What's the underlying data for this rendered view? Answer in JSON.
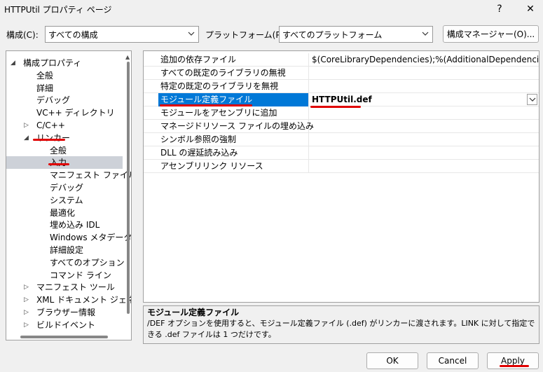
{
  "window": {
    "title": "HTTPUtil プロパティ ページ",
    "help_label": "?",
    "close_label": "✕"
  },
  "toolbar": {
    "config_label": "構成(C):",
    "config_value": "すべての構成",
    "platform_label": "プラットフォーム(P):",
    "platform_value": "すべてのプラットフォーム",
    "manager_button": "構成マネージャー(O)...",
    "dropdown_icon": "chevron-down-icon"
  },
  "tree": {
    "items": [
      {
        "label": "構成プロパティ",
        "level": 0,
        "expander": "expanded"
      },
      {
        "label": "全般",
        "level": 1,
        "expander": "none"
      },
      {
        "label": "詳細",
        "level": 1,
        "expander": "none"
      },
      {
        "label": "デバッグ",
        "level": 1,
        "expander": "none"
      },
      {
        "label": "VC++ ディレクトリ",
        "level": 1,
        "expander": "none"
      },
      {
        "label": "C/C++",
        "level": 1,
        "expander": "collapsed"
      },
      {
        "label": "リンカー",
        "level": 1,
        "expander": "expanded"
      },
      {
        "label": "全般",
        "level": 2,
        "expander": "none"
      },
      {
        "label": "入力",
        "level": 2,
        "expander": "none",
        "selected": true
      },
      {
        "label": "マニフェスト ファイル",
        "level": 2,
        "expander": "none"
      },
      {
        "label": "デバッグ",
        "level": 2,
        "expander": "none"
      },
      {
        "label": "システム",
        "level": 2,
        "expander": "none"
      },
      {
        "label": "最適化",
        "level": 2,
        "expander": "none"
      },
      {
        "label": "埋め込み IDL",
        "level": 2,
        "expander": "none"
      },
      {
        "label": "Windows メタデータ",
        "level": 2,
        "expander": "none"
      },
      {
        "label": "詳細設定",
        "level": 2,
        "expander": "none"
      },
      {
        "label": "すべてのオプション",
        "level": 2,
        "expander": "none"
      },
      {
        "label": "コマンド ライン",
        "level": 2,
        "expander": "none"
      },
      {
        "label": "マニフェスト ツール",
        "level": 1,
        "expander": "collapsed"
      },
      {
        "label": "XML ドキュメント ジェネレ",
        "level": 1,
        "expander": "collapsed"
      },
      {
        "label": "ブラウザー情報",
        "level": 1,
        "expander": "collapsed"
      },
      {
        "label": "ビルドイベント",
        "level": 1,
        "expander": "collapsed"
      }
    ]
  },
  "grid": {
    "rows": [
      {
        "name": "追加の依存ファイル",
        "value": "$(CoreLibraryDependencies);%(AdditionalDependencies)"
      },
      {
        "name": "すべての既定のライブラリの無視",
        "value": ""
      },
      {
        "name": "特定の既定のライブラリを無視",
        "value": ""
      },
      {
        "name": "モジュール定義ファイル",
        "value": "HTTPUtil.def",
        "selected": true
      },
      {
        "name": "モジュールをアセンブリに追加",
        "value": ""
      },
      {
        "name": "マネージドリソース ファイルの埋め込み",
        "value": ""
      },
      {
        "name": "シンボル参照の強制",
        "value": ""
      },
      {
        "name": "DLL の遅延読み込み",
        "value": ""
      },
      {
        "name": "アセンブリリンク リソース",
        "value": ""
      }
    ]
  },
  "description": {
    "title": "モジュール定義ファイル",
    "text": "/DEF オプションを使用すると、モジュール定義ファイル (.def) がリンカーに渡されます。LINK に対して指定できる .def ファイルは 1 つだけです。"
  },
  "buttons": {
    "ok": "OK",
    "cancel": "Cancel",
    "apply": "Apply"
  },
  "colors": {
    "selection": "#0078d7",
    "annotation": "#e00000"
  }
}
